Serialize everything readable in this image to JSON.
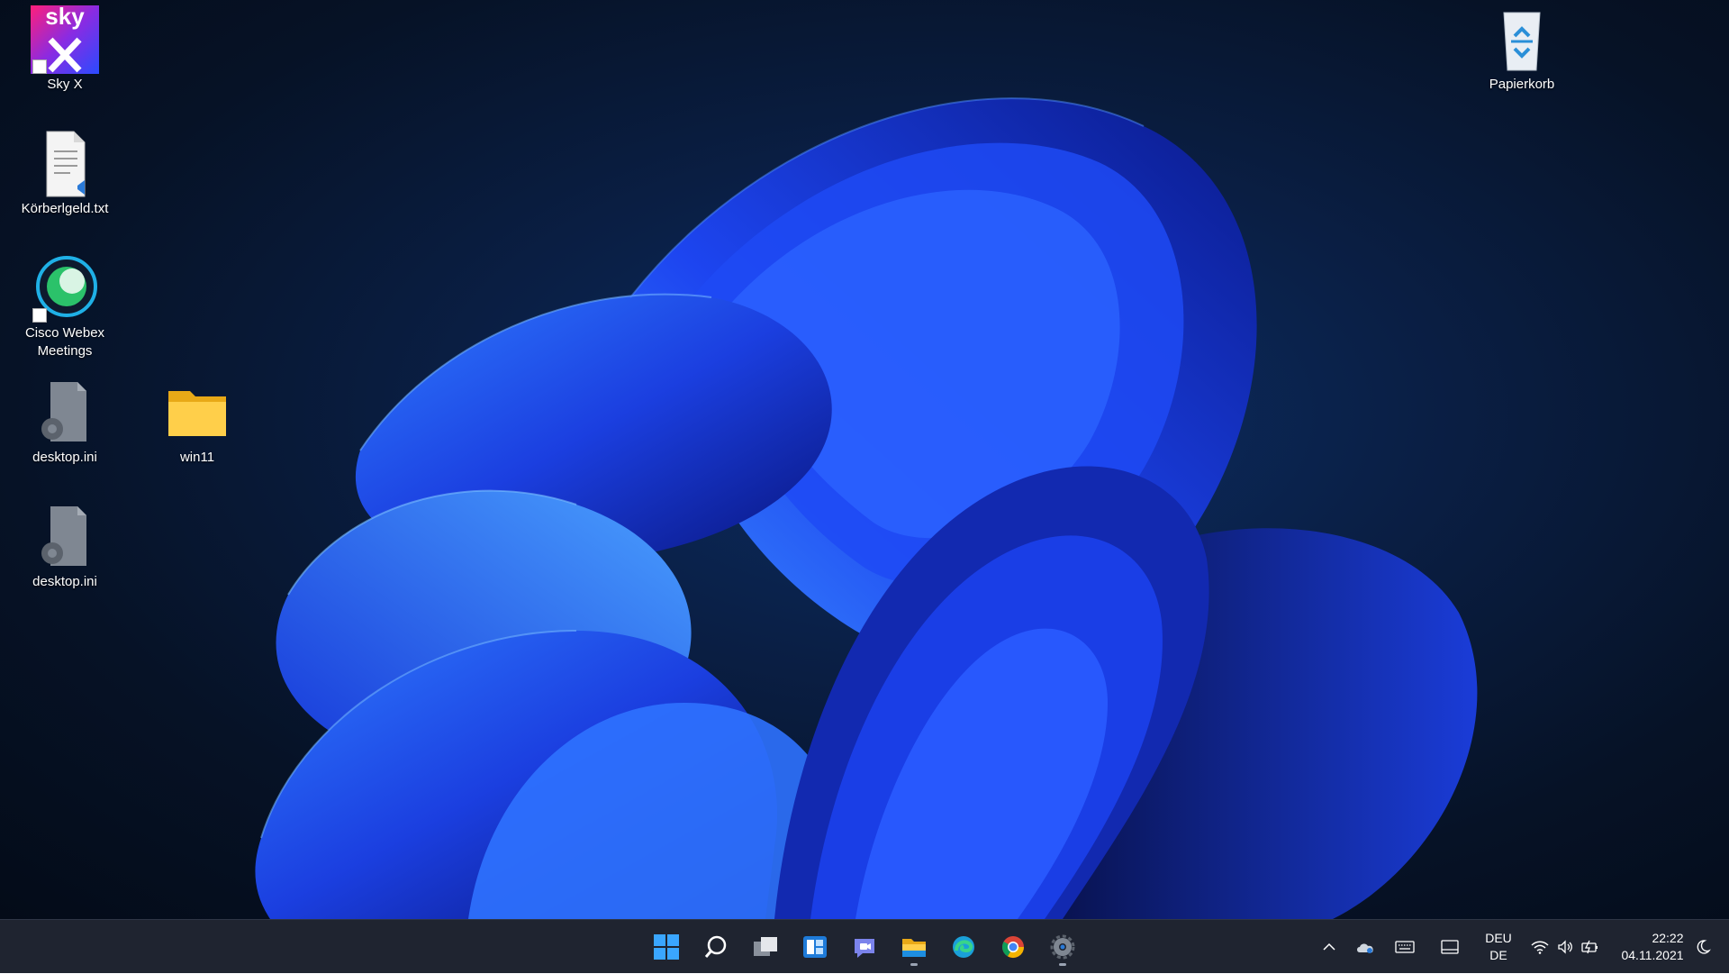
{
  "desktop": {
    "icons": [
      {
        "label": "Sky X",
        "sky_text": "sky"
      },
      {
        "label": "Körberlgeld.txt"
      },
      {
        "label": "Cisco Webex Meetings"
      },
      {
        "label": "desktop.ini"
      },
      {
        "label": "win11"
      },
      {
        "label": "desktop.ini"
      },
      {
        "label": "Papierkorb"
      }
    ]
  },
  "taskbar": {
    "apps": [
      {
        "name": "start-icon",
        "running": false
      },
      {
        "name": "search-icon",
        "running": false
      },
      {
        "name": "task-view-icon",
        "running": false
      },
      {
        "name": "widgets-icon",
        "running": false
      },
      {
        "name": "teams-chat-icon",
        "running": false
      },
      {
        "name": "file-explorer-icon",
        "running": true
      },
      {
        "name": "edge-icon",
        "running": false
      },
      {
        "name": "chrome-icon",
        "running": false
      },
      {
        "name": "settings-icon",
        "running": true
      }
    ],
    "tray": {
      "language_line1": "DEU",
      "language_line2": "DE",
      "time": "22:22",
      "date": "04.11.2021"
    }
  },
  "colors": {
    "taskbar_bg": "#1f2430",
    "accent": "#0078d4",
    "wallpaper_blue": "#1f4fff"
  }
}
